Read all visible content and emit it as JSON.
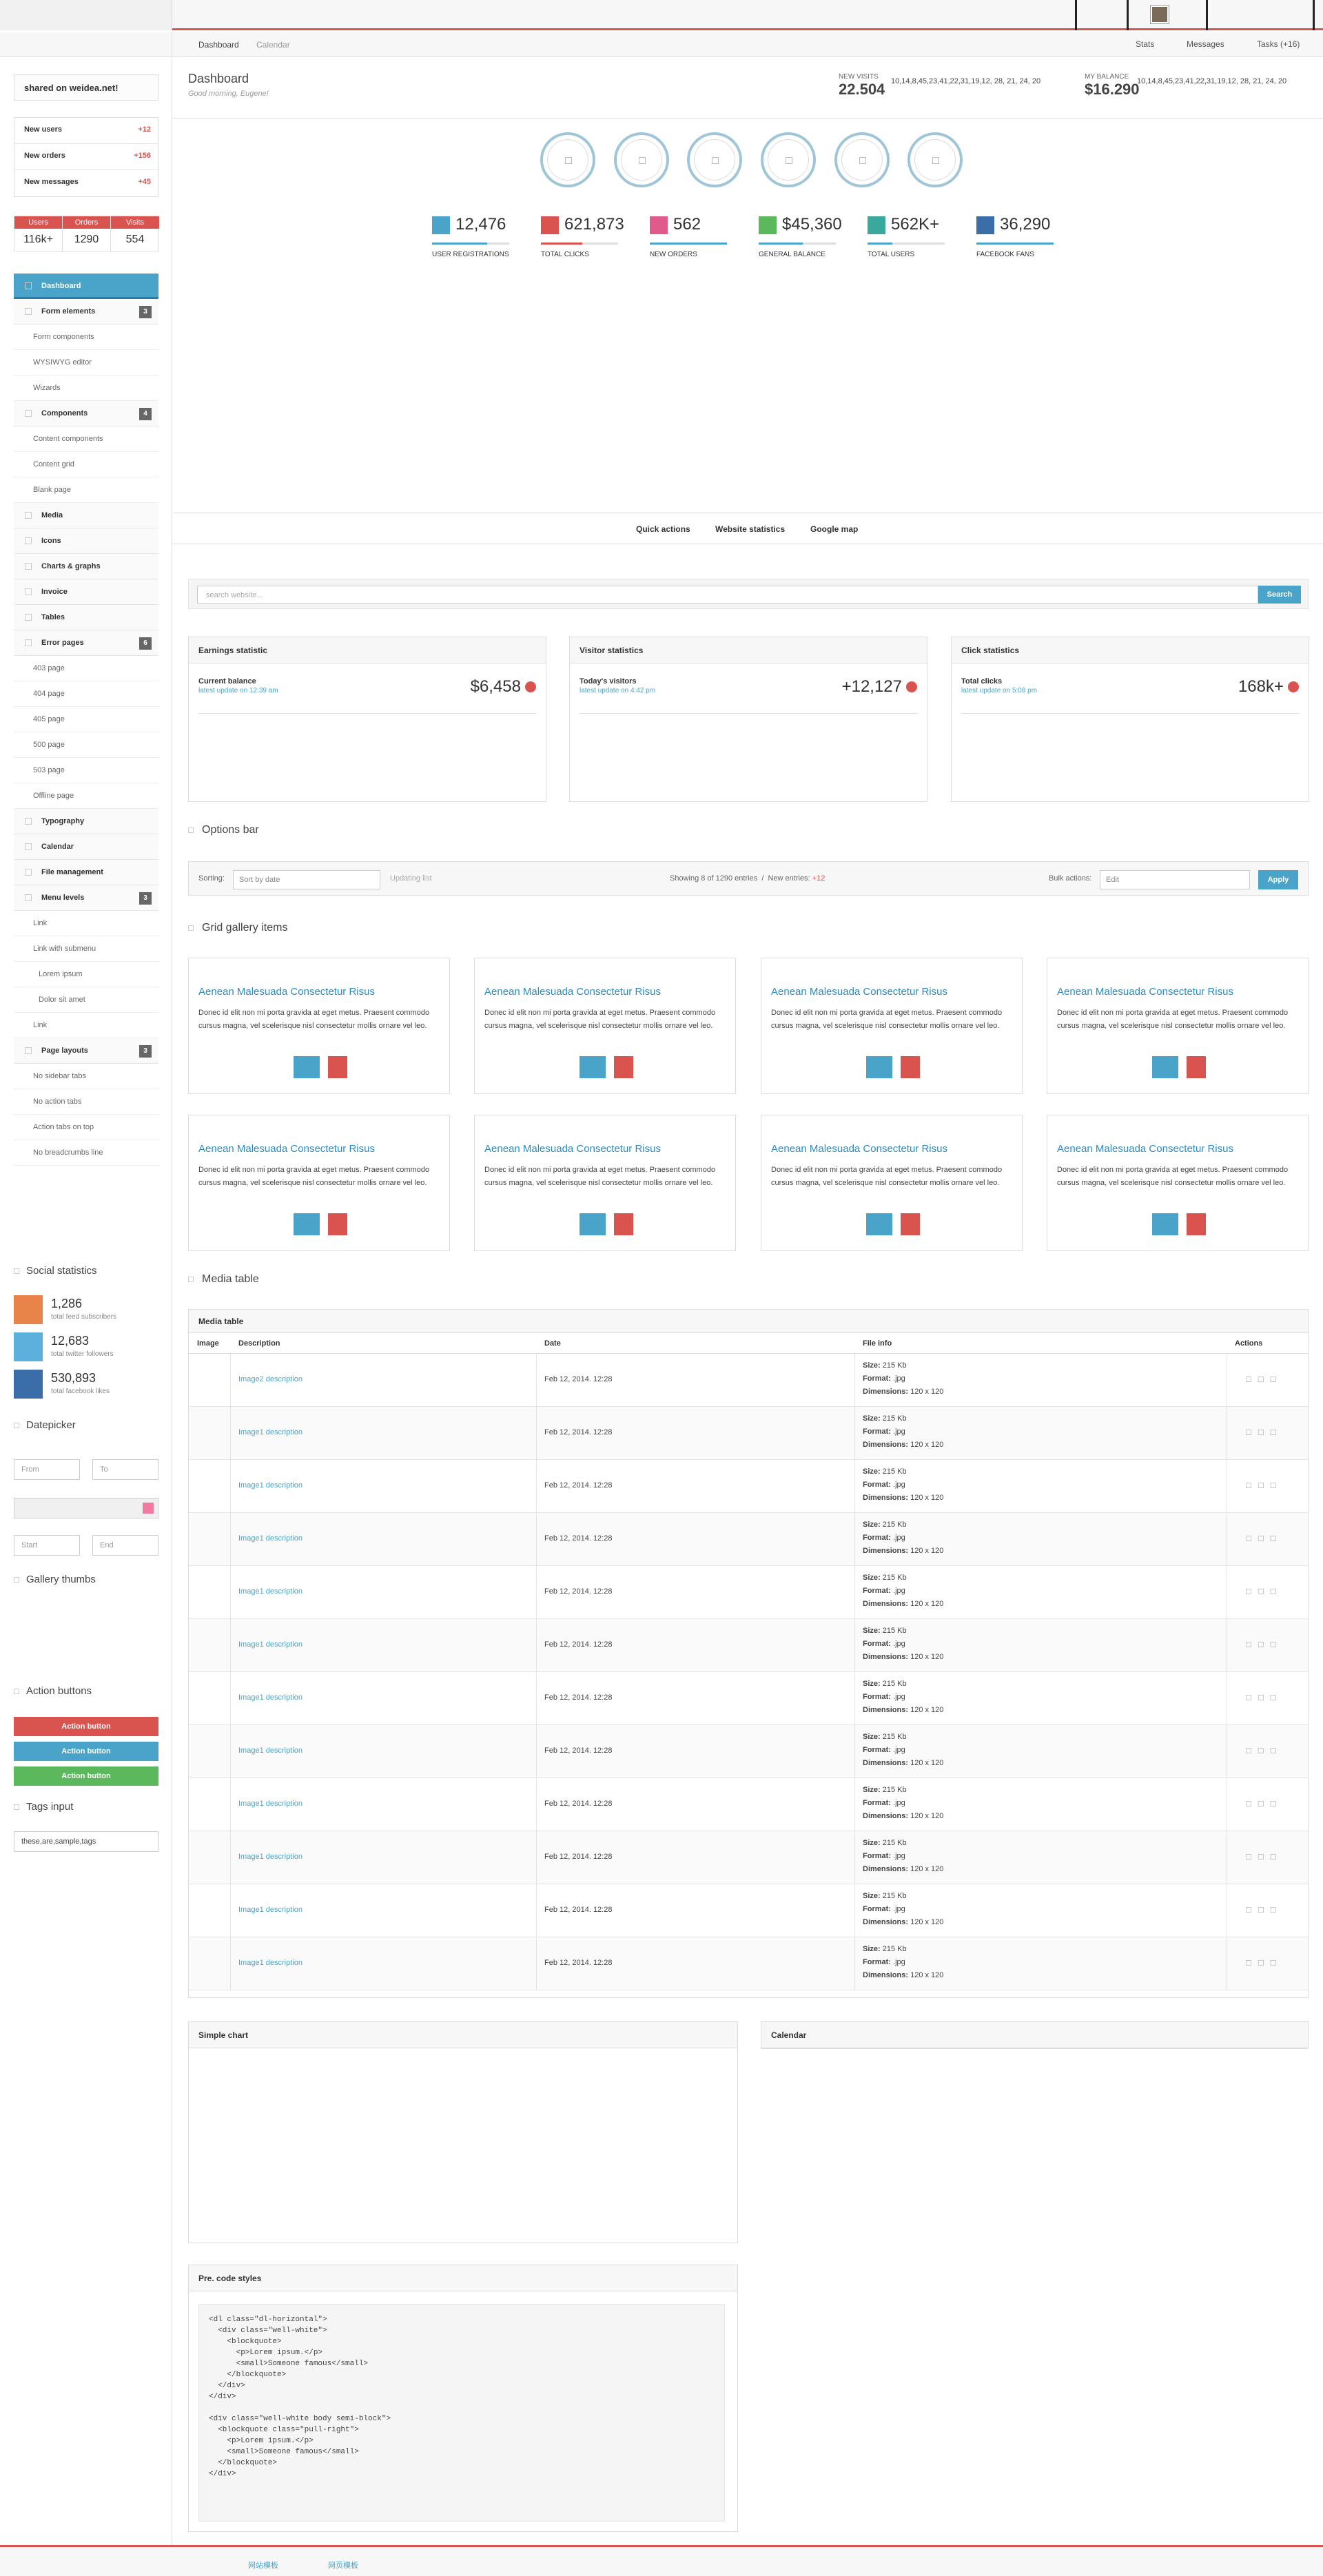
{
  "topbar": {
    "brand_colors": {
      "accent": "#d9534f",
      "primary": "#4aa4c9"
    }
  },
  "subnav": {
    "breadcrumb": [
      "Dashboard",
      "Calendar"
    ],
    "stats_label": "Stats",
    "messages_label": "Messages",
    "tasks_label": "Tasks",
    "tasks_count": "(+16)"
  },
  "sidebar": {
    "share": "shared on weidea.net!",
    "counters": [
      {
        "label": "New users",
        "value": "+12"
      },
      {
        "label": "New orders",
        "value": "+156"
      },
      {
        "label": "New messages",
        "value": "+45"
      }
    ],
    "stats3": [
      {
        "label": "Users",
        "value": "116k+"
      },
      {
        "label": "Orders",
        "value": "1290"
      },
      {
        "label": "Visits",
        "value": "554"
      }
    ],
    "nav": [
      {
        "type": "item",
        "label": "Dashboard",
        "active": true
      },
      {
        "type": "item",
        "label": "Form elements",
        "badge": "3"
      },
      {
        "type": "sub",
        "label": "Form components"
      },
      {
        "type": "sub",
        "label": "WYSIWYG editor"
      },
      {
        "type": "sub",
        "label": "Wizards"
      },
      {
        "type": "item",
        "label": "Components",
        "badge": "4"
      },
      {
        "type": "sub",
        "label": "Content components"
      },
      {
        "type": "sub",
        "label": "Content grid"
      },
      {
        "type": "sub",
        "label": "Blank page"
      },
      {
        "type": "item",
        "label": "Media"
      },
      {
        "type": "item",
        "label": "Icons"
      },
      {
        "type": "item",
        "label": "Charts & graphs"
      },
      {
        "type": "item",
        "label": "Invoice"
      },
      {
        "type": "item",
        "label": "Tables"
      },
      {
        "type": "item",
        "label": "Error pages",
        "badge": "6"
      },
      {
        "type": "sub",
        "label": "403 page"
      },
      {
        "type": "sub",
        "label": "404 page"
      },
      {
        "type": "sub",
        "label": "405 page"
      },
      {
        "type": "sub",
        "label": "500 page"
      },
      {
        "type": "sub",
        "label": "503 page"
      },
      {
        "type": "sub",
        "label": "Offline page"
      },
      {
        "type": "item",
        "label": "Typography"
      },
      {
        "type": "item",
        "label": "Calendar"
      },
      {
        "type": "item",
        "label": "File management"
      },
      {
        "type": "item",
        "label": "Menu levels",
        "badge": "3"
      },
      {
        "type": "sub",
        "label": "Link"
      },
      {
        "type": "sub",
        "label": "Link with submenu"
      },
      {
        "type": "deep",
        "label": "Lorem ipsum"
      },
      {
        "type": "deep",
        "label": "Dolor sit amet"
      },
      {
        "type": "sub",
        "label": "Link"
      },
      {
        "type": "item",
        "label": "Page layouts",
        "badge": "3"
      },
      {
        "type": "sub",
        "label": "No sidebar tabs"
      },
      {
        "type": "sub",
        "label": "No action tabs"
      },
      {
        "type": "sub",
        "label": "Action tabs on top"
      },
      {
        "type": "sub",
        "label": "No breadcrumbs line"
      }
    ],
    "social_title": "Social statistics",
    "social": [
      {
        "value": "1,286",
        "label": "total feed subscribers",
        "color": "#e8844a"
      },
      {
        "value": "12,683",
        "label": "total twitter followers",
        "color": "#5bb0dc"
      },
      {
        "value": "530,893",
        "label": "total facebook likes",
        "color": "#3b6ea8"
      }
    ],
    "datepicker_title": "Datepicker",
    "date_from": "From",
    "date_to": "To",
    "date_start": "Start",
    "date_end": "End",
    "gallery_title": "Gallery thumbs",
    "action_title": "Action buttons",
    "action_buttons": [
      {
        "label": "Action button",
        "color": "#d9534f"
      },
      {
        "label": "Action button",
        "color": "#4aa4c9"
      },
      {
        "label": "Action button",
        "color": "#5cb85c"
      }
    ],
    "tags_title": "Tags input",
    "tags_value": "these,are,sample,tags"
  },
  "main": {
    "title": "Dashboard",
    "subtitle": "Good morning, Eugene!",
    "new_visits_label": "NEW VISITS",
    "new_visits_value": "22.504",
    "new_visits_spark": "10,14,8,45,23,41,22,31,19,12, 28, 21, 24, 20",
    "balance_label": "MY BALANCE",
    "balance_value": "$16.290",
    "balance_spark": "10,14,8,45,23,41,22,31,19,12, 28, 21, 24, 20",
    "kpis": [
      {
        "value": "12,476",
        "label": "USER REGISTRATIONS",
        "color": "#4aa4c9"
      },
      {
        "value": "621,873",
        "label": "TOTAL CLICKS",
        "color": "#d9534f"
      },
      {
        "value": "562",
        "label": "NEW ORDERS",
        "color": "#e05a8c"
      },
      {
        "value": "$45,360",
        "label": "GENERAL BALANCE",
        "color": "#5cb85c"
      },
      {
        "value": "562K+",
        "label": "TOTAL USERS",
        "color": "#3aa89c"
      },
      {
        "value": "36,290",
        "label": "FACEBOOK FANS",
        "color": "#3b6ea8"
      }
    ],
    "tabs": [
      "Quick actions",
      "Website statistics",
      "Google map"
    ],
    "search_placeholder": "search website...",
    "search_button": "Search",
    "stat_panels": [
      {
        "title": "Earnings statistic",
        "label": "Current balance",
        "update": "latest update on 12:39 am",
        "value": "$6,458"
      },
      {
        "title": "Visitor statistics",
        "label": "Today's visitors",
        "update": "latest update on 4:42 pm",
        "value": "+12,127"
      },
      {
        "title": "Click statistics",
        "label": "Total clicks",
        "update": "latest update on 5:08 pm",
        "value": "168k+"
      }
    ],
    "options_title": "Options bar",
    "sorting_label": "Sorting:",
    "sort_select": "Sort by date",
    "updating_list": "Updating list",
    "showing_text": "Showing 8 of 1290 entries",
    "new_entries_label": "New entries:",
    "new_entries_value": "+12",
    "bulk_label": "Bulk actions:",
    "bulk_select": "Edit",
    "apply_button": "Apply",
    "gallery_title": "Grid gallery items",
    "gallery_item_title": "Aenean Malesuada Consectetur Risus",
    "gallery_item_text": "Donec id elit non mi porta gravida at eget metus. Praesent commodo cursus magna, vel scelerisque nisl consectetur mollis ornare vel leo.",
    "media_section_title": "Media table",
    "media_panel_title": "Media table",
    "media_cols": [
      "Image",
      "Description",
      "Date",
      "File info",
      "Actions"
    ],
    "media_rows": [
      {
        "desc": "Image2 description",
        "date": "Feb 12, 2014. 12:28"
      },
      {
        "desc": "Image1 description",
        "date": "Feb 12, 2014. 12:28"
      },
      {
        "desc": "Image1 description",
        "date": "Feb 12, 2014. 12:28"
      },
      {
        "desc": "Image1 description",
        "date": "Feb 12, 2014. 12:28"
      },
      {
        "desc": "Image1 description",
        "date": "Feb 12, 2014. 12:28"
      },
      {
        "desc": "Image1 description",
        "date": "Feb 12, 2014. 12:28"
      },
      {
        "desc": "Image1 description",
        "date": "Feb 12, 2014. 12:28"
      },
      {
        "desc": "Image1 description",
        "date": "Feb 12, 2014. 12:28"
      },
      {
        "desc": "Image1 description",
        "date": "Feb 12, 2014. 12:28"
      },
      {
        "desc": "Image1 description",
        "date": "Feb 12, 2014. 12:28"
      },
      {
        "desc": "Image1 description",
        "date": "Feb 12, 2014. 12:28"
      },
      {
        "desc": "Image1 description",
        "date": "Feb 12, 2014. 12:28"
      }
    ],
    "file_size": "215 Kb",
    "file_format": ".jpg",
    "file_dims": "120 x 120",
    "size_label": "Size:",
    "format_label": "Format:",
    "dims_label": "Dimensions:",
    "simple_chart_title": "Simple chart",
    "calendar_title": "Calendar",
    "pre_title": "Pre. code styles",
    "pre_code": "<dl class=\"dl-horizontal\">\n  <div class=\"well-white\">\n    <blockquote>\n      <p>Lorem ipsum.</p>\n      <small>Someone famous</small>\n    </blockquote>\n  </div>\n</div>\n\n<div class=\"well-white body semi-block\">\n  <blockquote class=\"pull-right\">\n    <p>Lorem ipsum.</p>\n    <small>Someone famous</small>\n  </blockquote>\n</div>"
  },
  "footer": {
    "links": [
      "网站模板",
      "网页模板"
    ]
  }
}
